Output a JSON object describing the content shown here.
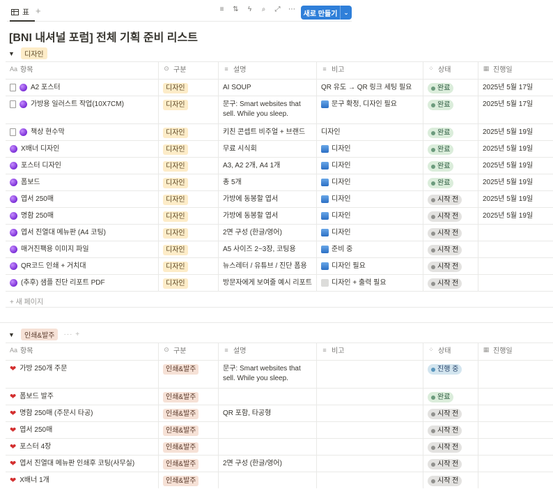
{
  "toolbar": {
    "view_icon": "table-icon",
    "view_label": "표",
    "add_view": "+",
    "new_button": "새로 만들기"
  },
  "page": {
    "title": "[BNI 내셔널 포럼] 전체 기획 준비 리스트"
  },
  "columns": {
    "name": "항목",
    "type": "구분",
    "desc": "설명",
    "note": "비고",
    "status": "상태",
    "date": "진행일"
  },
  "groups": [
    {
      "label": "디자인",
      "toggle": "▼",
      "add_page": "새 페이지",
      "rows": [
        {
          "icon": "doc+orb",
          "name": "A2 포스터",
          "type": "디자인",
          "desc": "AI SOUP",
          "note_icon": "",
          "note": "QR 유도 → QR 링크 세팅 필요",
          "status": "완료",
          "date": "2025년 5월 17일"
        },
        {
          "icon": "doc+orb",
          "name": "가방용 일러스트 작업(10X7CM)",
          "type": "디자인",
          "desc": "문구: Smart websites that sell. While you sleep.",
          "note_icon": "refresh",
          "note": "문구 확정, 디자인 필요",
          "status": "완료",
          "date": "2025년 5월 17일"
        },
        {
          "icon": "doc+orb",
          "name": "책상 현수막",
          "type": "디자인",
          "desc": "키친 콘셉트 비주얼 + 브랜드",
          "note_icon": "",
          "note": "디자인",
          "status": "완료",
          "date": "2025년 5월 19일"
        },
        {
          "icon": "orb",
          "name": "X배너 디자인",
          "type": "디자인",
          "desc": "무료 시식회",
          "note_icon": "refresh",
          "note": "디자인",
          "status": "완료",
          "date": "2025년 5월 19일"
        },
        {
          "icon": "orb",
          "name": "포스터 디자인",
          "type": "디자인",
          "desc": "A3, A2 2개, A4 1개",
          "note_icon": "refresh",
          "note": "디자인",
          "status": "완료",
          "date": "2025년 5월 19일"
        },
        {
          "icon": "orb",
          "name": "폼보드",
          "type": "디자인",
          "desc": "총 5개",
          "note_icon": "refresh",
          "note": "디자인",
          "status": "완료",
          "date": "2025년 5월 19일"
        },
        {
          "icon": "orb",
          "name": "엽서 250매",
          "type": "디자인",
          "desc": "가방에 동봉할 엽서",
          "note_icon": "refresh",
          "note": "디자인",
          "status": "시작 전",
          "date": "2025년 5월 19일"
        },
        {
          "icon": "orb",
          "name": "명함 250매",
          "type": "디자인",
          "desc": "가방에 동봉할 엽서",
          "note_icon": "refresh",
          "note": "디자인",
          "status": "시작 전",
          "date": "2025년 5월 19일"
        },
        {
          "icon": "orb",
          "name": "엽서 진열대 메뉴판 (A4 코팅)",
          "type": "디자인",
          "desc": "2면 구성 (한글/영어)",
          "note_icon": "refresh",
          "note": "디자인",
          "status": "시작 전",
          "date": ""
        },
        {
          "icon": "orb",
          "name": "매거진팩용 이미지 파일",
          "type": "디자인",
          "desc": "A5 사이즈 2~3장, 코팅용",
          "note_icon": "refresh",
          "note": "준비 중",
          "status": "시작 전",
          "date": ""
        },
        {
          "icon": "orb",
          "name": "QR코드 인쇄 + 거치대",
          "type": "디자인",
          "desc": "뉴스레터 / 유튜브 / 진단 폼용",
          "note_icon": "refresh",
          "note": "디자인 필요",
          "status": "시작 전",
          "date": ""
        },
        {
          "icon": "orb",
          "name": "(추후) 샘플 진단 리포트 PDF",
          "type": "디자인",
          "desc": "방문자에게 보여줄 예시 리포트",
          "note_icon": "box",
          "note": "디자인 + 출력 필요",
          "status": "시작 전",
          "date": ""
        }
      ]
    },
    {
      "label": "인쇄&발주",
      "toggle": "▼",
      "extra": "··· +",
      "rows": [
        {
          "icon": "heart",
          "name": "가방 250개 주문",
          "type": "인쇄&발주",
          "desc": "문구: Smart websites that sell. While you sleep.",
          "note_icon": "",
          "note": "",
          "status": "진행 중",
          "date": ""
        },
        {
          "icon": "heart",
          "name": "폼보드 발주",
          "type": "인쇄&발주",
          "desc": "",
          "note_icon": "",
          "note": "",
          "status": "완료",
          "date": ""
        },
        {
          "icon": "heart",
          "name": "명함 250매 (주문시 타공)",
          "type": "인쇄&발주",
          "desc": "QR 포함, 타공형",
          "note_icon": "",
          "note": "",
          "status": "시작 전",
          "date": ""
        },
        {
          "icon": "heart",
          "name": "엽서 250매",
          "type": "인쇄&발주",
          "desc": "",
          "note_icon": "",
          "note": "",
          "status": "시작 전",
          "date": ""
        },
        {
          "icon": "heart",
          "name": "포스터 4장",
          "type": "인쇄&발주",
          "desc": "",
          "note_icon": "",
          "note": "",
          "status": "시작 전",
          "date": ""
        },
        {
          "icon": "heart",
          "name": "엽서 진열대 메뉴판 인쇄후 코팅(사무실)",
          "type": "인쇄&발주",
          "desc": "2면 구성 (한글/영어)",
          "note_icon": "",
          "note": "",
          "status": "시작 전",
          "date": ""
        },
        {
          "icon": "heart",
          "name": "X배너 1개",
          "type": "인쇄&발주",
          "desc": "",
          "note_icon": "",
          "note": "",
          "status": "시작 전",
          "date": ""
        }
      ]
    }
  ],
  "colors": {
    "accent": "#2f7fd9",
    "design_tag": "#fdecc8",
    "print_tag": "#f6e1d6",
    "status_done": "#dbeddb",
    "status_todo": "#e3e2e0",
    "status_progress": "#d3e5ef"
  }
}
